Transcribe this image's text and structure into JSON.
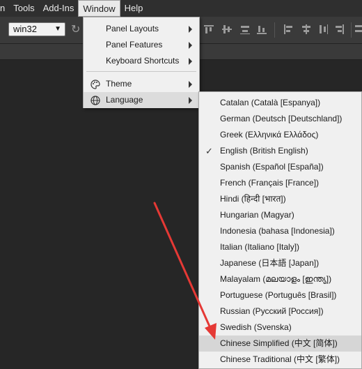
{
  "menubar": {
    "items": [
      {
        "label": "n"
      },
      {
        "label": "Tools"
      },
      {
        "label": "Add-Ins"
      },
      {
        "label": "Window"
      },
      {
        "label": "Help"
      }
    ]
  },
  "toolbar": {
    "platform_value": "win32"
  },
  "window_menu": {
    "items": [
      {
        "label": "Panel Layouts"
      },
      {
        "label": "Panel Features"
      },
      {
        "label": "Keyboard Shortcuts"
      },
      {
        "label": "Theme"
      },
      {
        "label": "Language"
      }
    ]
  },
  "language_menu": {
    "items": [
      {
        "label": "Catalan (Català [Espanya])"
      },
      {
        "label": "German (Deutsch [Deutschland])"
      },
      {
        "label": "Greek (Ελληνικά Ελλάδος)"
      },
      {
        "label": "English (British English)"
      },
      {
        "label": "Spanish (Español [España])"
      },
      {
        "label": "French (Français [France])"
      },
      {
        "label": "Hindi (हिन्दी [भारत])"
      },
      {
        "label": "Hungarian (Magyar)"
      },
      {
        "label": "Indonesia (bahasa [Indonesia])"
      },
      {
        "label": "Italian (Italiano [Italy])"
      },
      {
        "label": "Japanese (日本語 [Japan])"
      },
      {
        "label": "Malayalam (മലയാളം [ഇന്ത്യ])"
      },
      {
        "label": "Portuguese (Português [Brasil])"
      },
      {
        "label": "Russian (Русский [Россия])"
      },
      {
        "label": "Swedish (Svenska)"
      },
      {
        "label": "Chinese Simplified (中文 [简体])"
      },
      {
        "label": "Chinese Traditional (中文 [繁体])"
      }
    ],
    "checked_icon": "checkmark-icon",
    "highlight_color": "#d6d6d6"
  },
  "annotation": {
    "arrow_color": "#e53935"
  }
}
